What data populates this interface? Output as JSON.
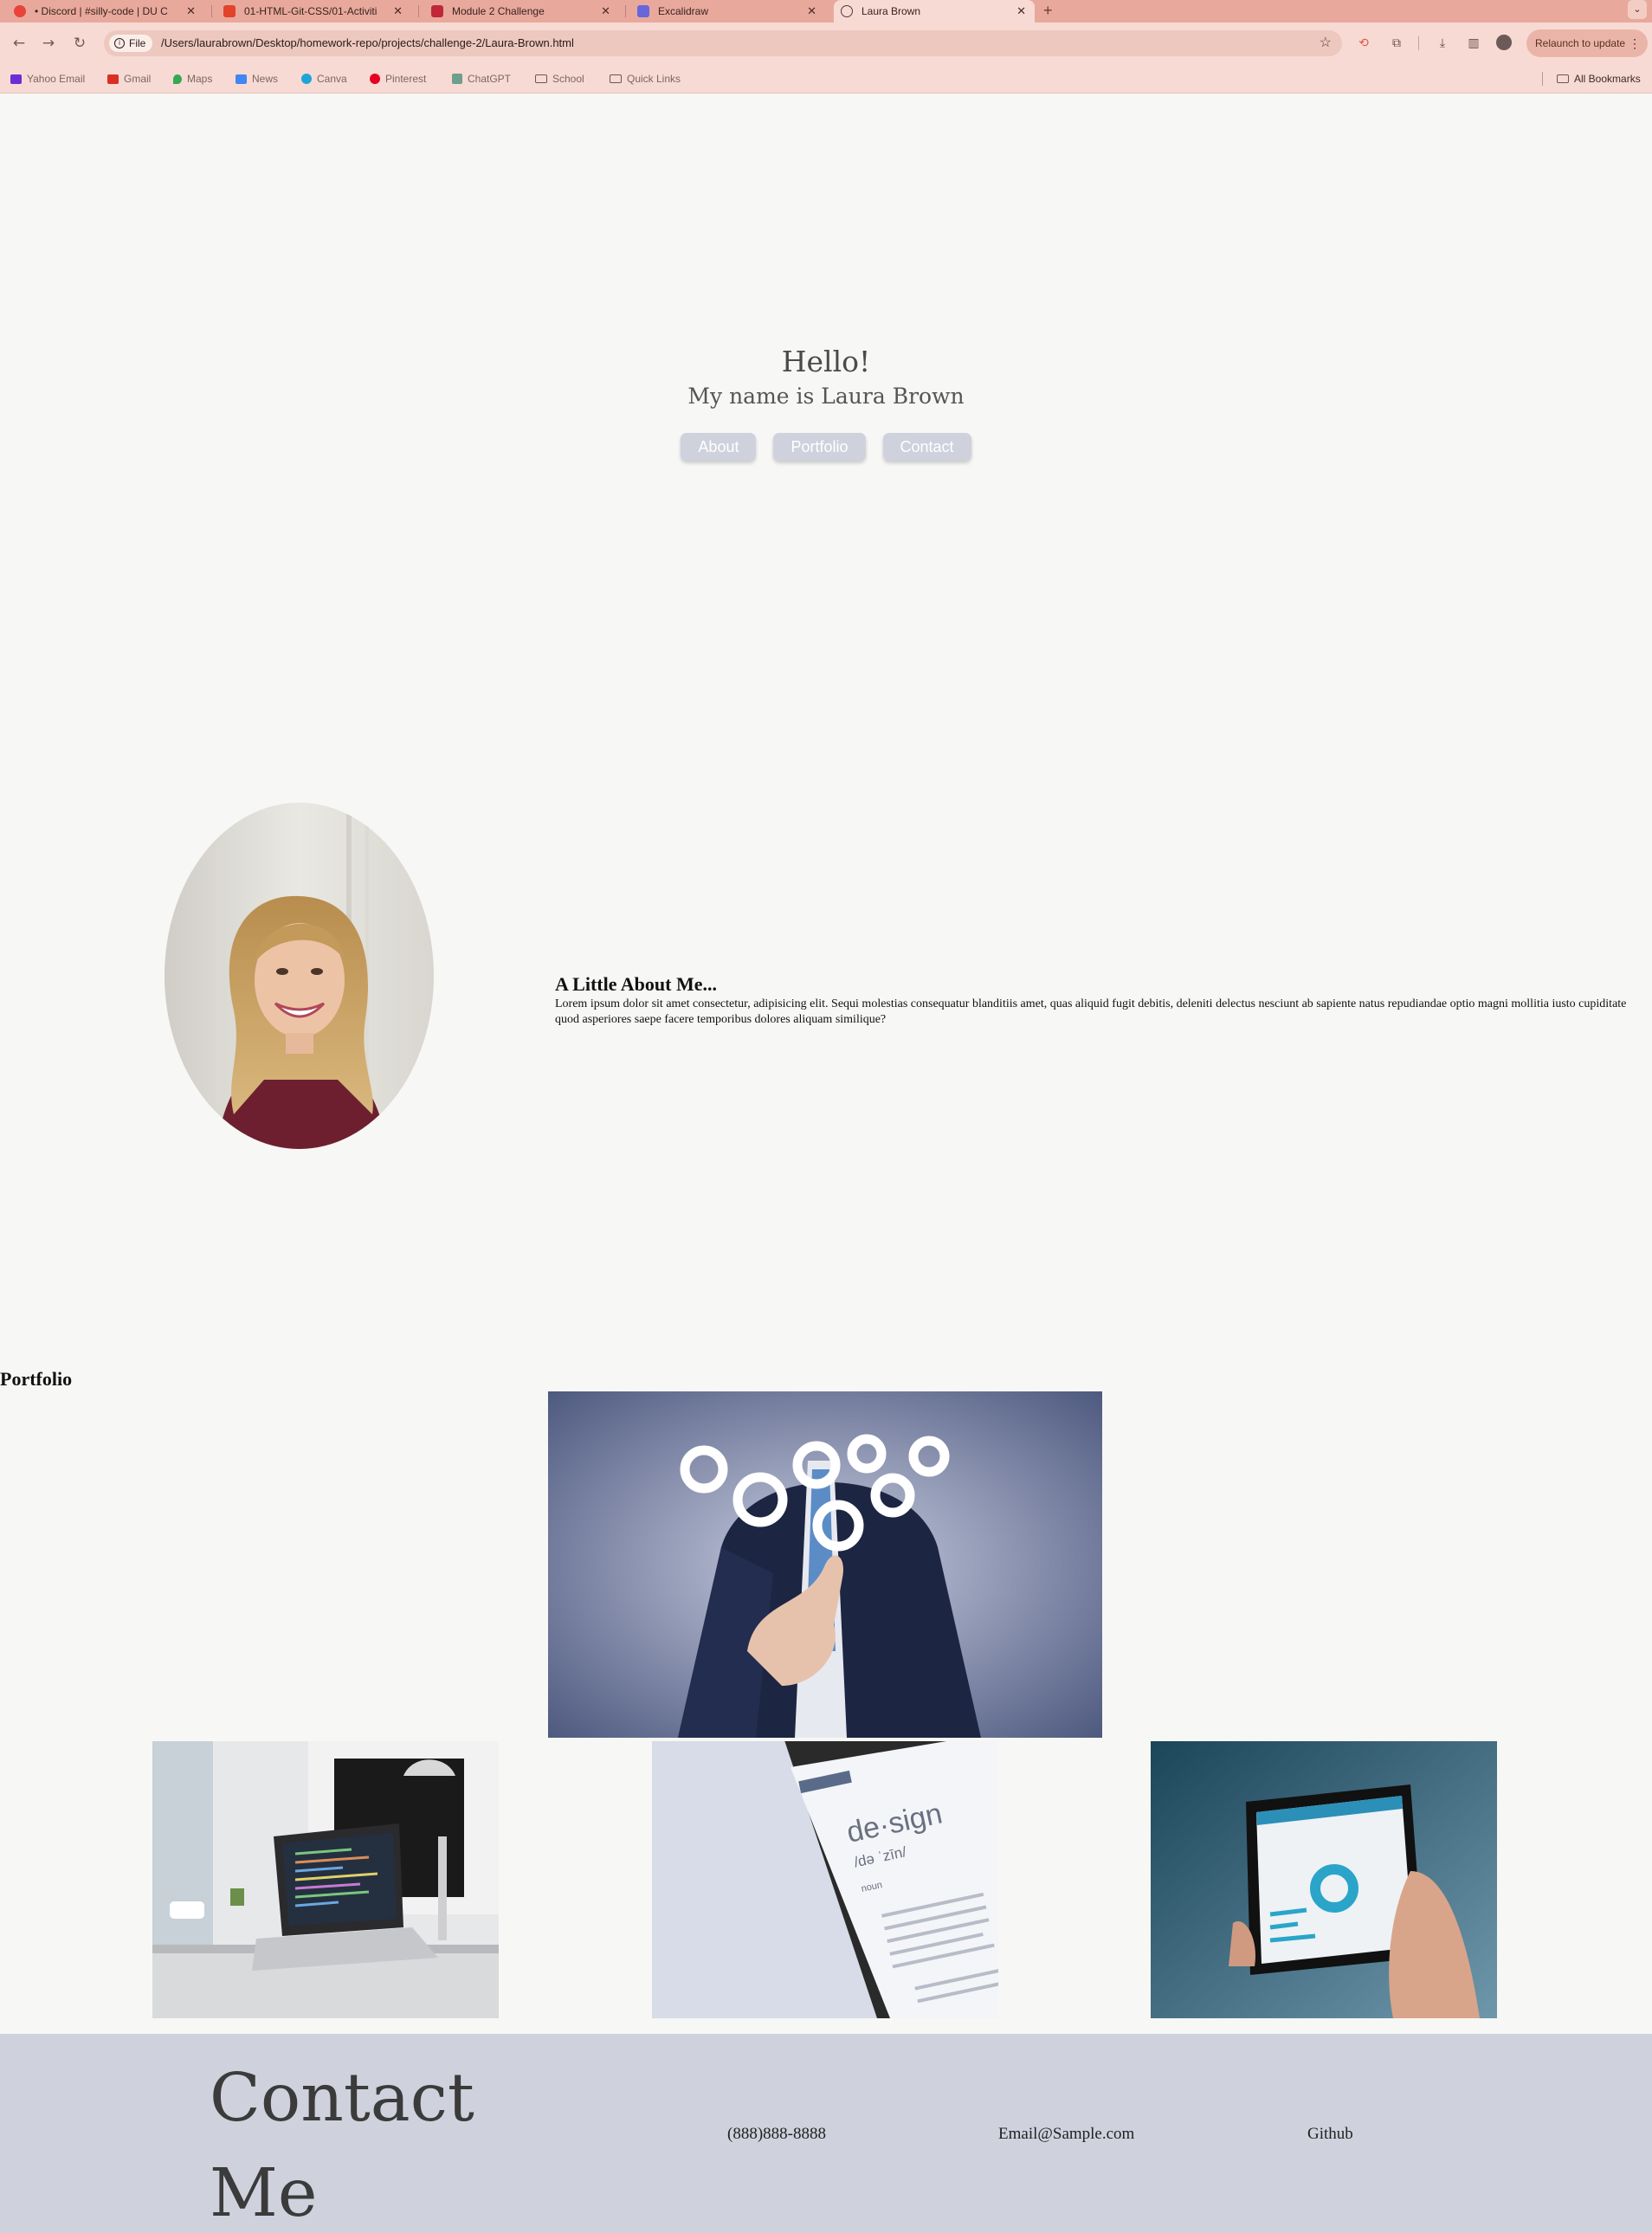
{
  "browser": {
    "tabs": [
      {
        "label": "• Discord | #silly-code | DU C",
        "active": false
      },
      {
        "label": "01-HTML-Git-CSS/01-Activiti",
        "active": false
      },
      {
        "label": "Module 2 Challenge",
        "active": false
      },
      {
        "label": "Excalidraw",
        "active": false
      },
      {
        "label": "Laura Brown",
        "active": true
      }
    ],
    "new_tab": "+",
    "address_chip": "File",
    "url": "/Users/laurabrown/Desktop/homework-repo/projects/challenge-2/Laura-Brown.html",
    "relaunch_label": "Relaunch to update",
    "bookmarks": [
      {
        "label": "Yahoo Email",
        "color": "#6b2dd6",
        "folder": false
      },
      {
        "label": "Gmail",
        "color": "#d93025",
        "folder": false
      },
      {
        "label": "Maps",
        "color": "#34a853",
        "folder": false
      },
      {
        "label": "News",
        "color": "#4285f4",
        "folder": false
      },
      {
        "label": "Canva",
        "color": "#1fa4d8",
        "folder": false
      },
      {
        "label": "Pinterest",
        "color": "#e60023",
        "folder": false
      },
      {
        "label": "ChatGPT",
        "color": "#6e9e8c",
        "folder": false
      },
      {
        "label": "School",
        "color": "",
        "folder": true
      },
      {
        "label": "Quick Links",
        "color": "",
        "folder": true
      }
    ],
    "all_bookmarks": "All Bookmarks"
  },
  "hero": {
    "greeting": "Hello!",
    "name_line": "My name is Laura Brown",
    "nav": [
      "About",
      "Portfolio",
      "Contact"
    ]
  },
  "about": {
    "title": "A Little About Me...",
    "text": "Lorem ipsum dolor sit amet consectetur, adipisicing elit. Sequi molestias consequatur blanditiis amet, quas aliquid fugit debitis, deleniti delectus nesciunt ab sapiente natus repudiandae optio magni mollitia iusto cupiditate quod asperiores saepe facere temporibus dolores aliquam similique?"
  },
  "portfolio": {
    "title": "Portfolio",
    "main_screen_word": "de·sign",
    "phonetic": "/də ˈzīn/",
    "word_type": "noun"
  },
  "contact": {
    "title": "Contact Me",
    "phone": "(888)888-8888",
    "email": "Email@Sample.com",
    "github": "Github"
  },
  "colors": {
    "tab_bar": "#e8a99c",
    "toolbar": "#f7dad3",
    "page_bg": "#f7f7f5",
    "button_bg": "#cfd1dd",
    "contact_bg": "#cfd1dd"
  }
}
